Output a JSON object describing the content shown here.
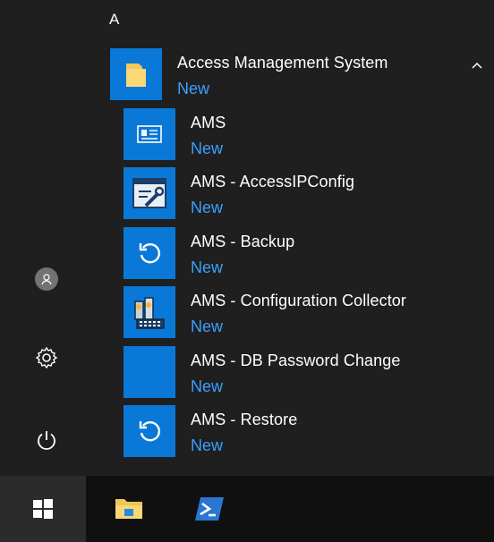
{
  "start_menu": {
    "section_letter": "A",
    "group": {
      "title": "Access Management System",
      "badge": "New",
      "expand_icon": "chevron-up-icon"
    },
    "apps": [
      {
        "name": "AMS",
        "badge": "New",
        "icon": "id-card-icon"
      },
      {
        "name": "AMS - AccessIPConfig",
        "badge": "New",
        "icon": "config-wrench-icon"
      },
      {
        "name": "AMS - Backup",
        "badge": "New",
        "icon": "backup-icon"
      },
      {
        "name": "AMS - Configuration Collector",
        "badge": "New",
        "icon": "config-collector-icon"
      },
      {
        "name": "AMS - DB Password Change",
        "badge": "New",
        "icon": "blank-tile"
      },
      {
        "name": "AMS - Restore",
        "badge": "New",
        "icon": "restore-icon"
      }
    ]
  },
  "left_rail": {
    "icons": [
      "user-icon",
      "settings-icon",
      "power-icon"
    ]
  },
  "taskbar": {
    "items": [
      "windows-start-icon",
      "file-explorer-icon",
      "powershell-icon"
    ]
  },
  "colors": {
    "accent": "#0a78d7",
    "badge": "#3aa0ff",
    "menu_bg": "#1f1f1f",
    "taskbar_bg": "#101010"
  }
}
